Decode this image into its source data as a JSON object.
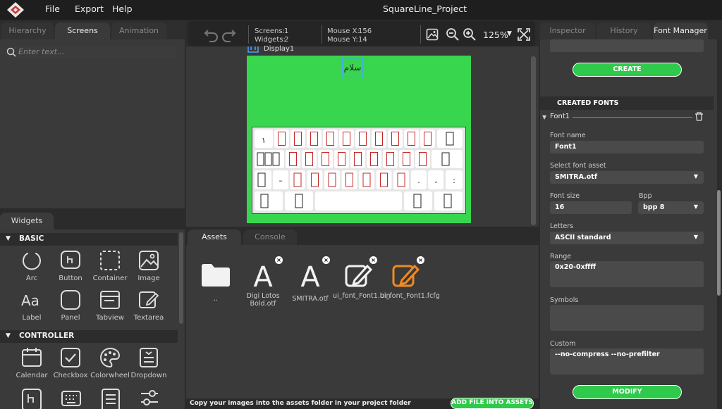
{
  "app": {
    "title": "SquareLine_Project"
  },
  "menu": [
    "File",
    "Export",
    "Help"
  ],
  "left_tabs": [
    "Hierarchy",
    "Screens",
    "Animation"
  ],
  "search": {
    "placeholder": "Enter text..."
  },
  "widgets_tab": "Widgets",
  "sections": {
    "basic": "BASIC",
    "controller": "CONTROLLER"
  },
  "basic_widgets": [
    "Arc",
    "Button",
    "Container",
    "Image",
    "Label",
    "Panel",
    "Tabview",
    "Textarea"
  ],
  "controller_widgets": [
    "Calendar",
    "Checkbox",
    "Colorwheel",
    "Dropdown"
  ],
  "toolbar": {
    "screens_label": "Screens:",
    "screens_value": "1",
    "widgets_label": "Widgets:",
    "widgets_value": "2",
    "mouse_x_label": "Mouse X:",
    "mouse_x_value": "156",
    "mouse_y_label": "Mouse Y:",
    "mouse_y_value": "14",
    "zoom": "125%"
  },
  "display": {
    "name": "Display1",
    "label_text": "سلام",
    "bg_color": "#38d64f"
  },
  "keyboard": {
    "row1_first": "١",
    "row3_keys": [
      "–",
      ".",
      "،",
      ":"
    ]
  },
  "assets_tabs": [
    "Assets",
    "Console"
  ],
  "assets": [
    {
      "name": "..",
      "kind": "folder"
    },
    {
      "name": "Digi Lotos Bold.otf",
      "kind": "font"
    },
    {
      "name": "SMITRA.otf",
      "kind": "font"
    },
    {
      "name": "ui_font_Font1.bin",
      "kind": "file"
    },
    {
      "name": "ui_font_Font1.fcfg",
      "kind": "file-selected"
    }
  ],
  "assets_footer": {
    "hint": "Copy your images into the assets folder in your project folder",
    "add_button": "ADD FILE INTO ASSETS"
  },
  "right_tabs": [
    "Inspector",
    "History",
    "Font Manager"
  ],
  "font_manager": {
    "create_button": "CREATE",
    "created_fonts_title": "CREATED FONTS",
    "font_item": "Font1",
    "font_name_label": "Font name",
    "font_name_value": "Font1",
    "asset_label": "Select font asset",
    "asset_value": "SMITRA.otf",
    "size_label": "Font size",
    "size_value": "16",
    "bpp_label": "Bpp",
    "bpp_value": "bpp 8",
    "letters_label": "Letters",
    "letters_value": "ASCII standard",
    "range_label": "Range",
    "range_value": "0x20-0xffff",
    "symbols_label": "Symbols",
    "symbols_value": "",
    "custom_label": "Custom",
    "custom_value": "--no-compress --no-prefilter",
    "modify_button": "MODIFY"
  }
}
